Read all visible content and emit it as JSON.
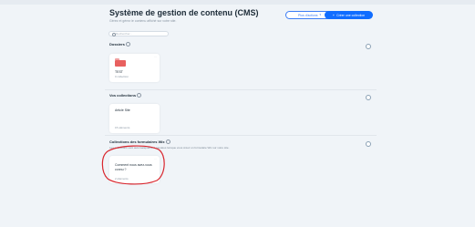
{
  "header": {
    "title": "Système de gestion de contenu (CMS)",
    "subtitle": "Gérez et gérez le contenu affiché sur votre site.",
    "more_actions_label": "Plus d'actions",
    "create_collection_label": "Créer une collection"
  },
  "search": {
    "placeholder": "Rechercher..."
  },
  "folders": {
    "title": "Dossiers",
    "items": [
      {
        "name": "TEST",
        "meta": "0 collection"
      }
    ]
  },
  "collections": {
    "title": "Vos collections",
    "items": [
      {
        "name": "Article Site",
        "meta": "15 éléments"
      }
    ]
  },
  "wix_forms": {
    "title": "Collections des formulaires Wix",
    "description": "Les collections sont automatiquement ajoutées lorsque vous créez un formulaire Wix sur votre site.",
    "items": [
      {
        "name": "Comment nous avez-vous connu ?",
        "meta": "2 éléments"
      }
    ]
  },
  "colors": {
    "background": "#f0f4f8",
    "accent": "#116dff",
    "folder": "#e8605f",
    "annotation": "#d9262e"
  }
}
